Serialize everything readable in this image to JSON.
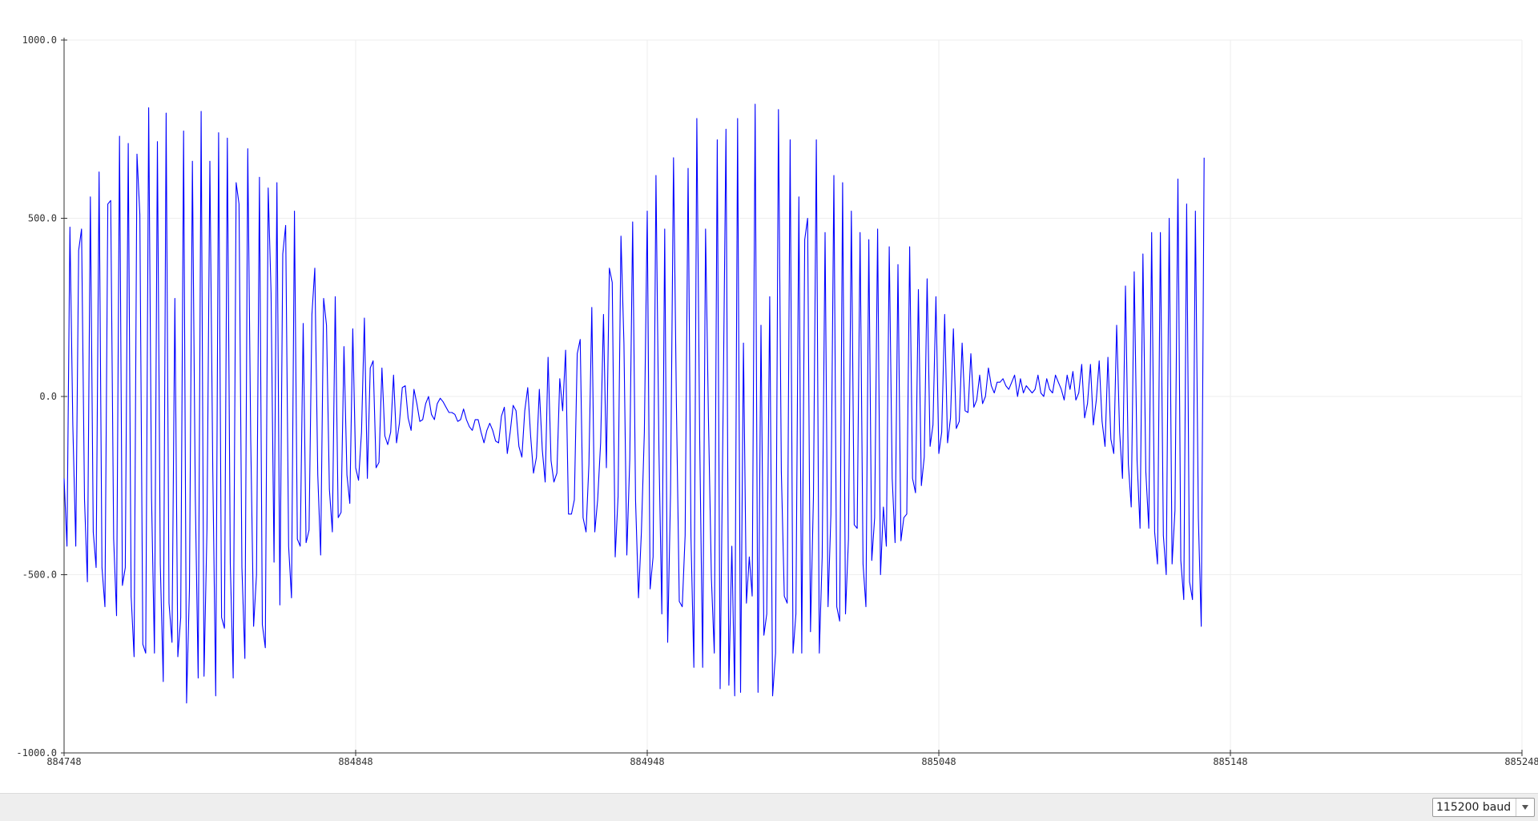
{
  "chart_data": {
    "type": "line",
    "xlim": [
      884748,
      885248
    ],
    "ylim": [
      -1000,
      1000
    ],
    "x_ticks": [
      "884748",
      "884848",
      "884948",
      "885048",
      "885148",
      "885248"
    ],
    "y_ticks": [
      "1000.0",
      "500.0",
      "0.0",
      "-500.0",
      "-1000.0"
    ],
    "grid": true,
    "series": [
      {
        "color": "#0000ff",
        "x_start": 884748,
        "x_step": 1,
        "values": [
          -230,
          -420,
          475,
          -80,
          -420,
          410,
          470,
          -290,
          -520,
          560,
          -380,
          -480,
          630,
          -480,
          -590,
          540,
          550,
          -400,
          -615,
          730,
          -530,
          -480,
          710,
          -560,
          -730,
          680,
          510,
          -695,
          -720,
          810,
          -285,
          -720,
          715,
          -470,
          -800,
          795,
          -580,
          -690,
          275,
          -730,
          -620,
          745,
          -860,
          -540,
          660,
          -280,
          -790,
          800,
          -785,
          -370,
          660,
          -200,
          -840,
          740,
          -620,
          -650,
          725,
          -470,
          -790,
          600,
          540,
          -480,
          -735,
          695,
          -120,
          -645,
          -500,
          615,
          -640,
          -705,
          585,
          290,
          -465,
          600,
          -585,
          400,
          480,
          -420,
          -565,
          520,
          -400,
          -420,
          205,
          -410,
          -375,
          230,
          360,
          -220,
          -445,
          275,
          200,
          -260,
          -380,
          280,
          -340,
          -325,
          140,
          -220,
          -300,
          190,
          -200,
          -235,
          -100,
          220,
          -230,
          80,
          100,
          -200,
          -185,
          80,
          -110,
          -135,
          -100,
          60,
          -130,
          -75,
          25,
          30,
          -60,
          -95,
          20,
          -20,
          -70,
          -65,
          -20,
          0,
          -50,
          -65,
          -20,
          -5,
          -15,
          -30,
          -45,
          -45,
          -50,
          -70,
          -65,
          -35,
          -65,
          -85,
          -95,
          -65,
          -65,
          -100,
          -130,
          -95,
          -75,
          -95,
          -125,
          -130,
          -55,
          -30,
          -160,
          -100,
          -25,
          -40,
          -140,
          -170,
          -40,
          25,
          -110,
          -215,
          -170,
          20,
          -150,
          -240,
          110,
          -180,
          -240,
          -215,
          50,
          -40,
          130,
          -330,
          -330,
          -290,
          120,
          160,
          -340,
          -380,
          -190,
          250,
          -380,
          -290,
          -130,
          230,
          -200,
          360,
          320,
          -450,
          -280,
          450,
          150,
          -445,
          -175,
          490,
          -290,
          -565,
          -380,
          -100,
          520,
          -540,
          -450,
          620,
          -150,
          -610,
          470,
          -690,
          -270,
          670,
          -20,
          -575,
          -590,
          -390,
          640,
          -395,
          -760,
          780,
          -120,
          -760,
          470,
          -60,
          -510,
          -720,
          720,
          -820,
          -60,
          750,
          -810,
          -420,
          -840,
          780,
          -830,
          150,
          -580,
          -450,
          -560,
          820,
          -830,
          200,
          -670,
          -610,
          280,
          -840,
          -720,
          805,
          -210,
          -560,
          -580,
          720,
          -720,
          -610,
          560,
          -720,
          440,
          500,
          -660,
          -280,
          720,
          -720,
          -450,
          460,
          -590,
          -330,
          620,
          -590,
          -630,
          600,
          -610,
          -400,
          520,
          -360,
          -370,
          460,
          -470,
          -590,
          440,
          -460,
          -340,
          470,
          -500,
          -310,
          -420,
          420,
          -230,
          -410,
          370,
          -405,
          -340,
          -330,
          420,
          -230,
          -270,
          300,
          -250,
          -170,
          330,
          -140,
          -80,
          280,
          -160,
          -100,
          230,
          -130,
          -60,
          190,
          -90,
          -70,
          150,
          -40,
          -45,
          120,
          -30,
          -10,
          60,
          -20,
          0,
          80,
          30,
          10,
          40,
          40,
          50,
          30,
          20,
          40,
          60,
          0,
          50,
          10,
          30,
          20,
          10,
          20,
          60,
          10,
          0,
          50,
          20,
          10,
          60,
          40,
          20,
          -10,
          60,
          20,
          70,
          -10,
          10,
          90,
          -60,
          -20,
          90,
          -80,
          -10,
          100,
          -70,
          -140,
          110,
          -120,
          -160,
          200,
          -100,
          -230,
          310,
          -190,
          -310,
          350,
          -180,
          -370,
          400,
          -210,
          -370,
          460,
          -380,
          -470,
          460,
          -390,
          -500,
          500,
          -470,
          -320,
          610,
          -460,
          -570,
          540,
          -520,
          -570,
          520,
          -340,
          -645,
          670
        ]
      }
    ]
  },
  "footer": {
    "baud_label": "115200 baud"
  }
}
